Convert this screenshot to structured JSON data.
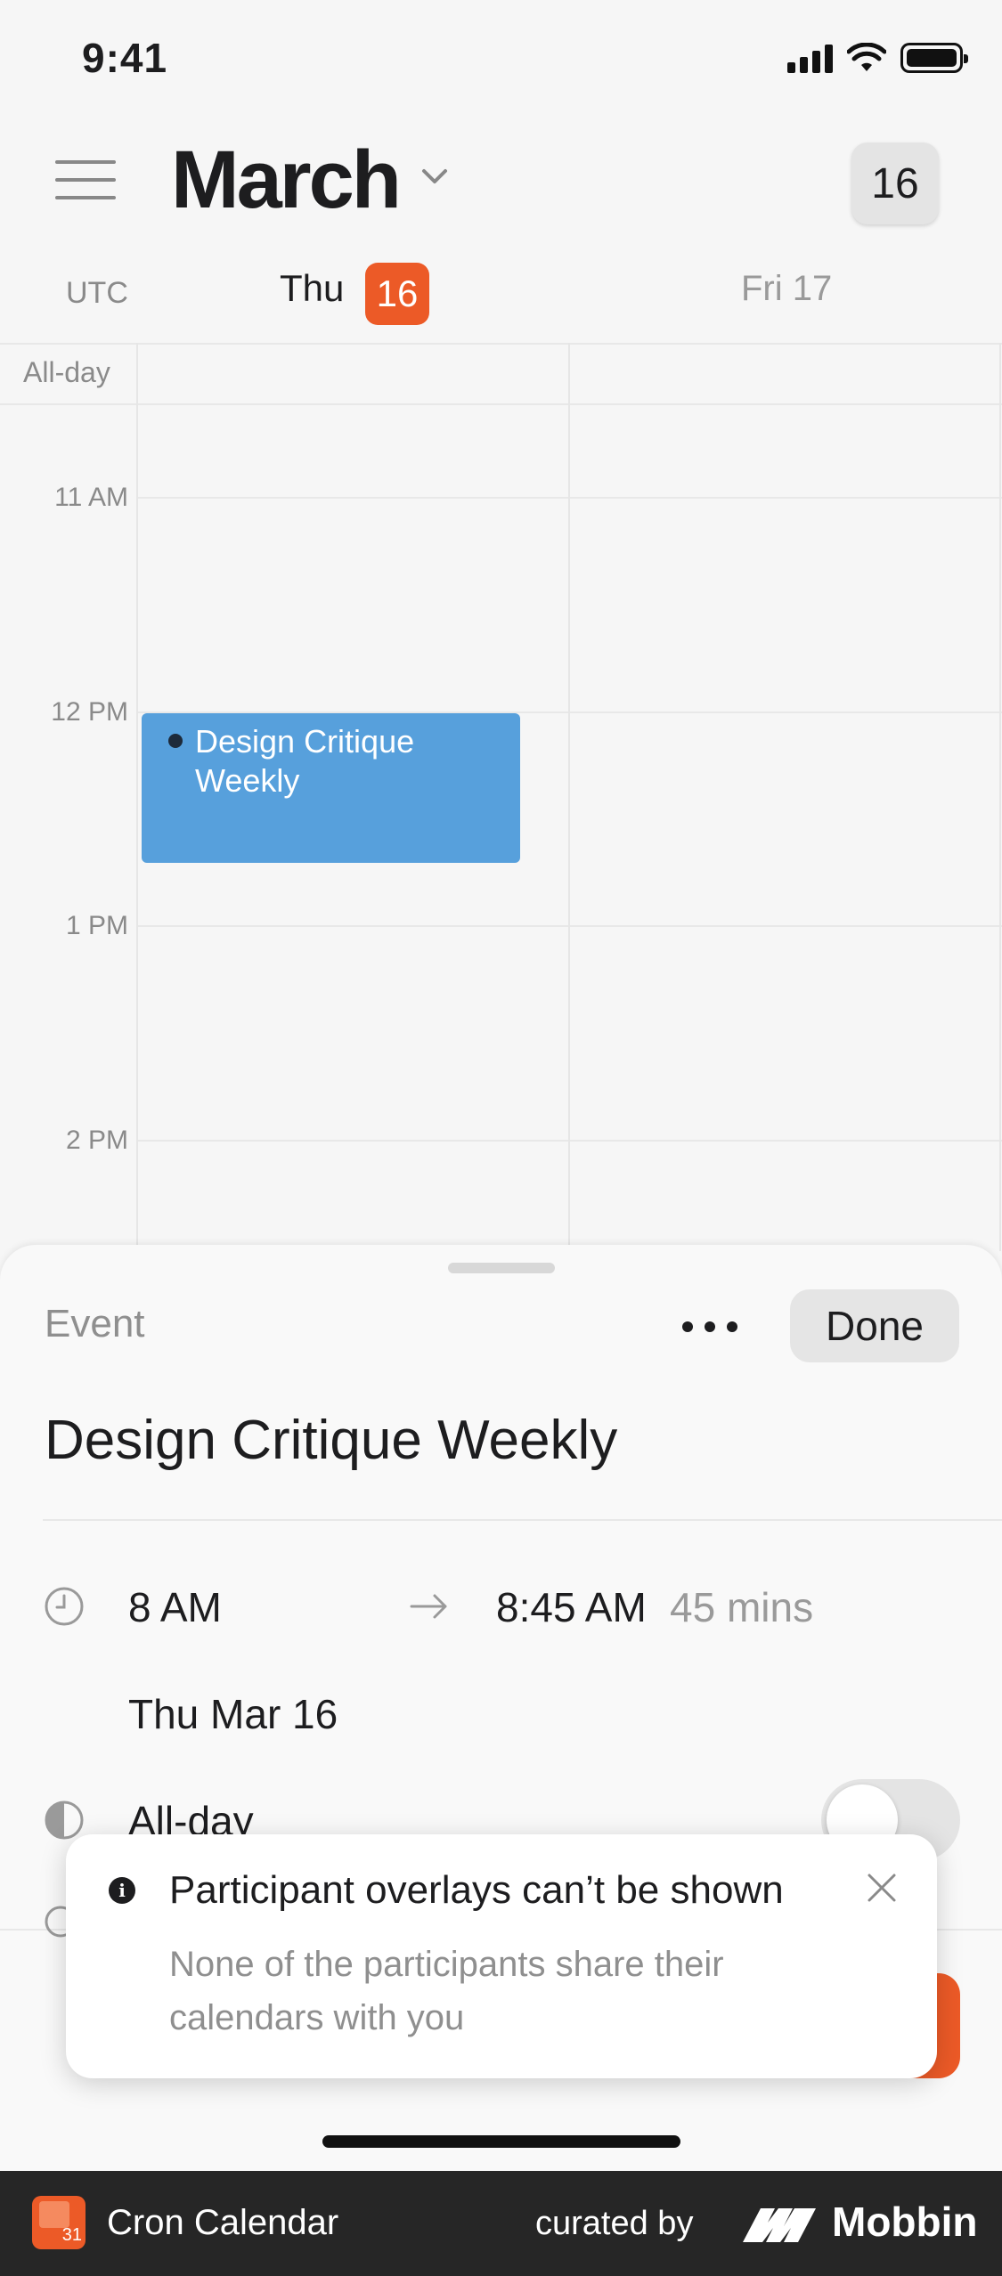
{
  "status_bar": {
    "time": "9:41"
  },
  "header": {
    "month": "March",
    "today_button": "16"
  },
  "day_header": {
    "timezone": "UTC",
    "day1_name": "Thu",
    "day1_num": "16",
    "day2": "Fri 17"
  },
  "grid": {
    "all_day_label": "All-day",
    "hours": [
      "11 AM",
      "12 PM",
      "1 PM",
      "2 PM"
    ]
  },
  "calendar_event": {
    "title": "Design Critique Weekly"
  },
  "sheet": {
    "heading": "Event",
    "done_label": "Done",
    "event_title": "Design Critique Weekly",
    "start_time": "8 AM",
    "end_time": "8:45 AM",
    "duration": "45 mins",
    "date": "Thu Mar 16",
    "all_day_label": "All-day",
    "all_day_on": false
  },
  "toast": {
    "title": "Participant overlays can’t be shown",
    "body": "None of the participants share their calendars with you"
  },
  "footer": {
    "app_name": "Cron Calendar",
    "logo_number": "31",
    "curated_by": "curated by",
    "brand": "Mobbin"
  },
  "colors": {
    "accent": "#ec5a27",
    "event_blue": "#57a0dc"
  }
}
